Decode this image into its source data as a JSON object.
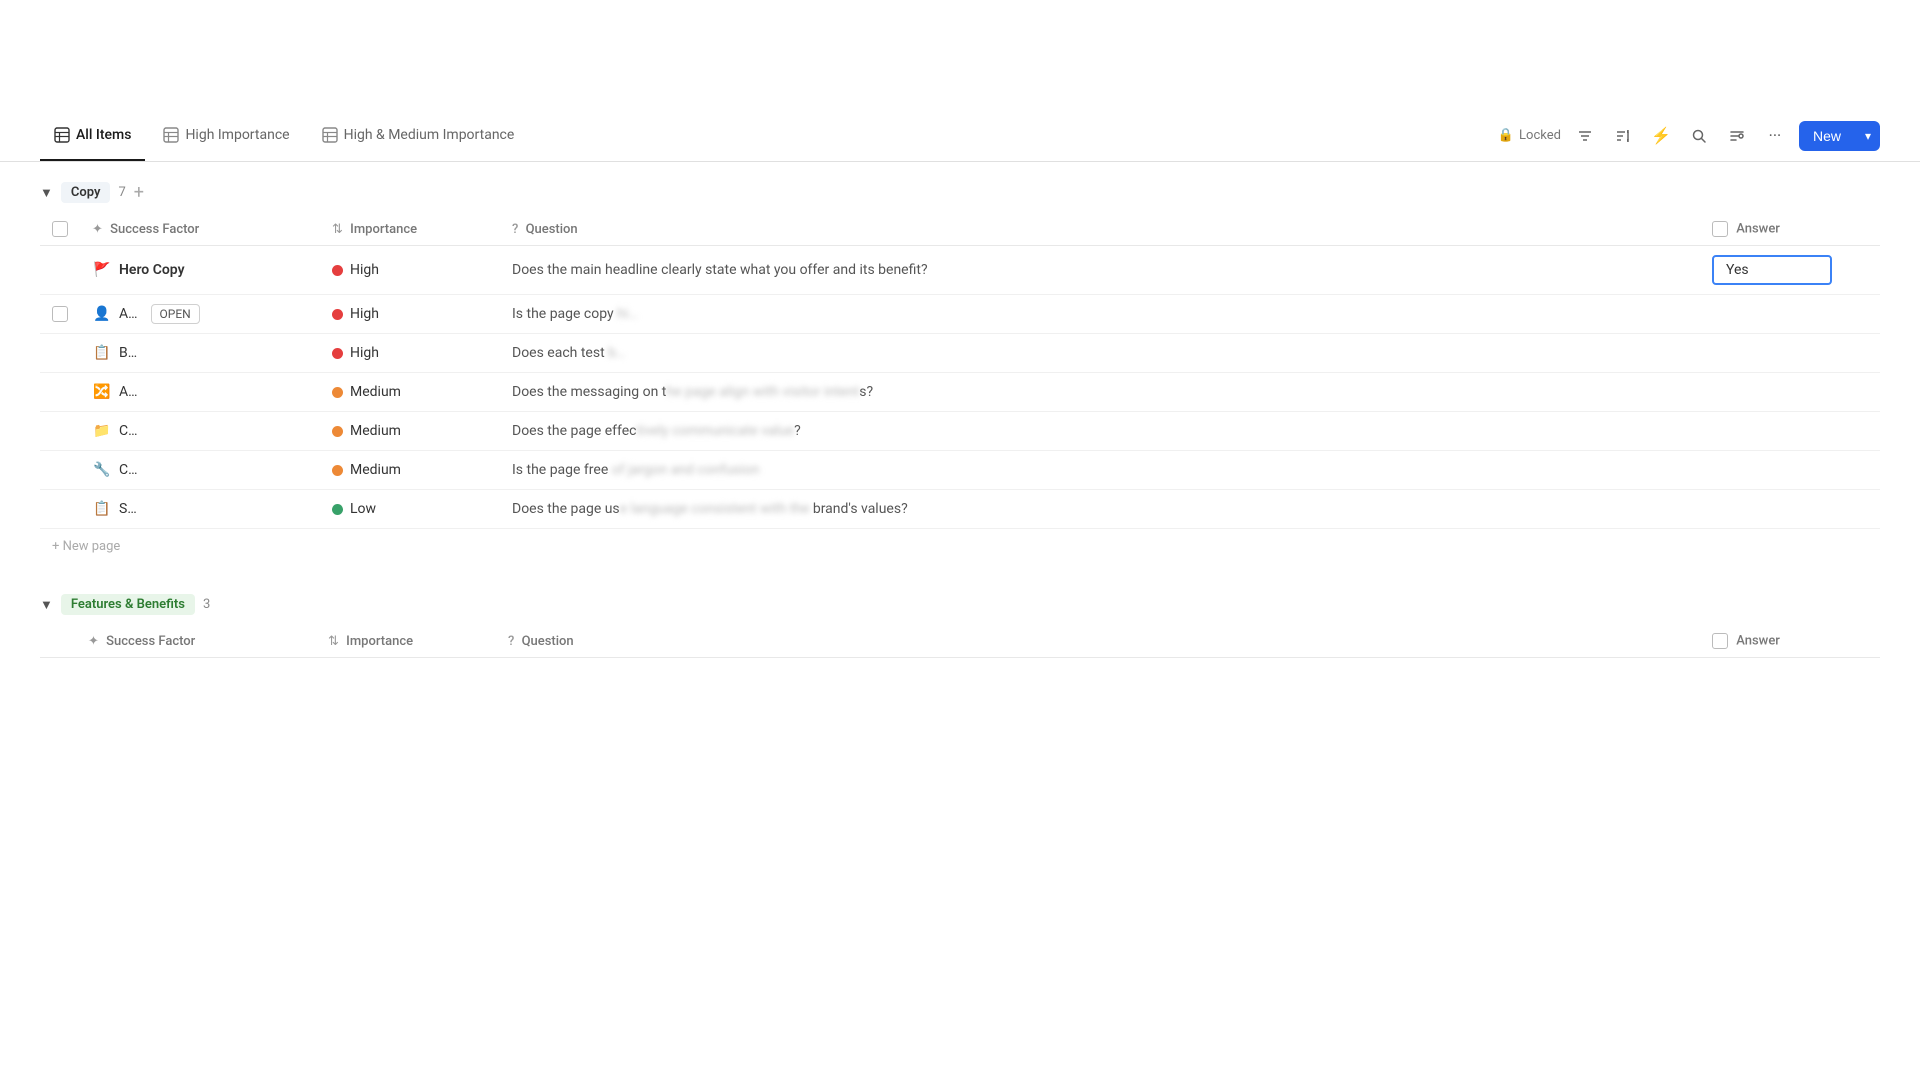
{
  "tabs": [
    {
      "id": "all-items",
      "label": "All Items",
      "active": true
    },
    {
      "id": "high-importance",
      "label": "High Importance",
      "active": false
    },
    {
      "id": "high-medium",
      "label": "High & Medium Importance",
      "active": false
    }
  ],
  "toolbar": {
    "locked_label": "Locked",
    "new_button": "New"
  },
  "copy_group": {
    "label": "Copy",
    "count": "7",
    "columns": {
      "success_factor": "Success Factor",
      "importance": "Importance",
      "question": "Question",
      "answer": "Answer"
    },
    "rows": [
      {
        "id": "hero",
        "icon": "🚩",
        "name": "Hero Copy",
        "importance_level": "High",
        "importance_color": "red",
        "question": "Does the main headline clearly state what you offer and its benefit?",
        "question_blurred": false,
        "answer": "Yes",
        "has_answer_box": true
      },
      {
        "id": "row2",
        "icon": "👤",
        "name": "A…",
        "importance_level": "High",
        "importance_color": "red",
        "question": "Is the page copy hi",
        "question_blurred": true,
        "has_open_badge": true,
        "answer": "",
        "has_answer_box": false
      },
      {
        "id": "row3",
        "icon": "📋",
        "name": "B…",
        "importance_level": "High",
        "importance_color": "red",
        "question": "Does each test b…",
        "question_blurred": true,
        "answer": "",
        "has_answer_box": false
      },
      {
        "id": "row4",
        "icon": "🔀",
        "name": "A…",
        "importance_level": "Medium",
        "importance_color": "orange",
        "question": "Does the messaging on t",
        "question_partial": "s?",
        "question_blurred": true,
        "answer": "",
        "has_answer_box": false
      },
      {
        "id": "row5",
        "icon": "📁",
        "name": "C…",
        "importance_level": "Medium",
        "importance_color": "orange",
        "question": "Does the page effec",
        "question_partial": "?",
        "question_blurred": true,
        "answer": "",
        "has_answer_box": false
      },
      {
        "id": "row6",
        "icon": "🔧",
        "name": "C…",
        "importance_level": "Medium",
        "importance_color": "orange",
        "question": "Is the page free",
        "question_blurred": true,
        "answer": "",
        "has_answer_box": false
      },
      {
        "id": "row7",
        "icon": "📋",
        "name": "S…",
        "importance_level": "Low",
        "importance_color": "green",
        "question": "Does the page us",
        "question_suffix": "brand's values?",
        "question_blurred": true,
        "answer": "",
        "has_answer_box": false
      }
    ],
    "new_page_label": "+ New page"
  },
  "features_group": {
    "label": "Features & Benefits",
    "count": "3",
    "columns": {
      "success_factor": "Success Factor",
      "importance": "Importance",
      "question": "Question",
      "answer": "Answer"
    }
  }
}
